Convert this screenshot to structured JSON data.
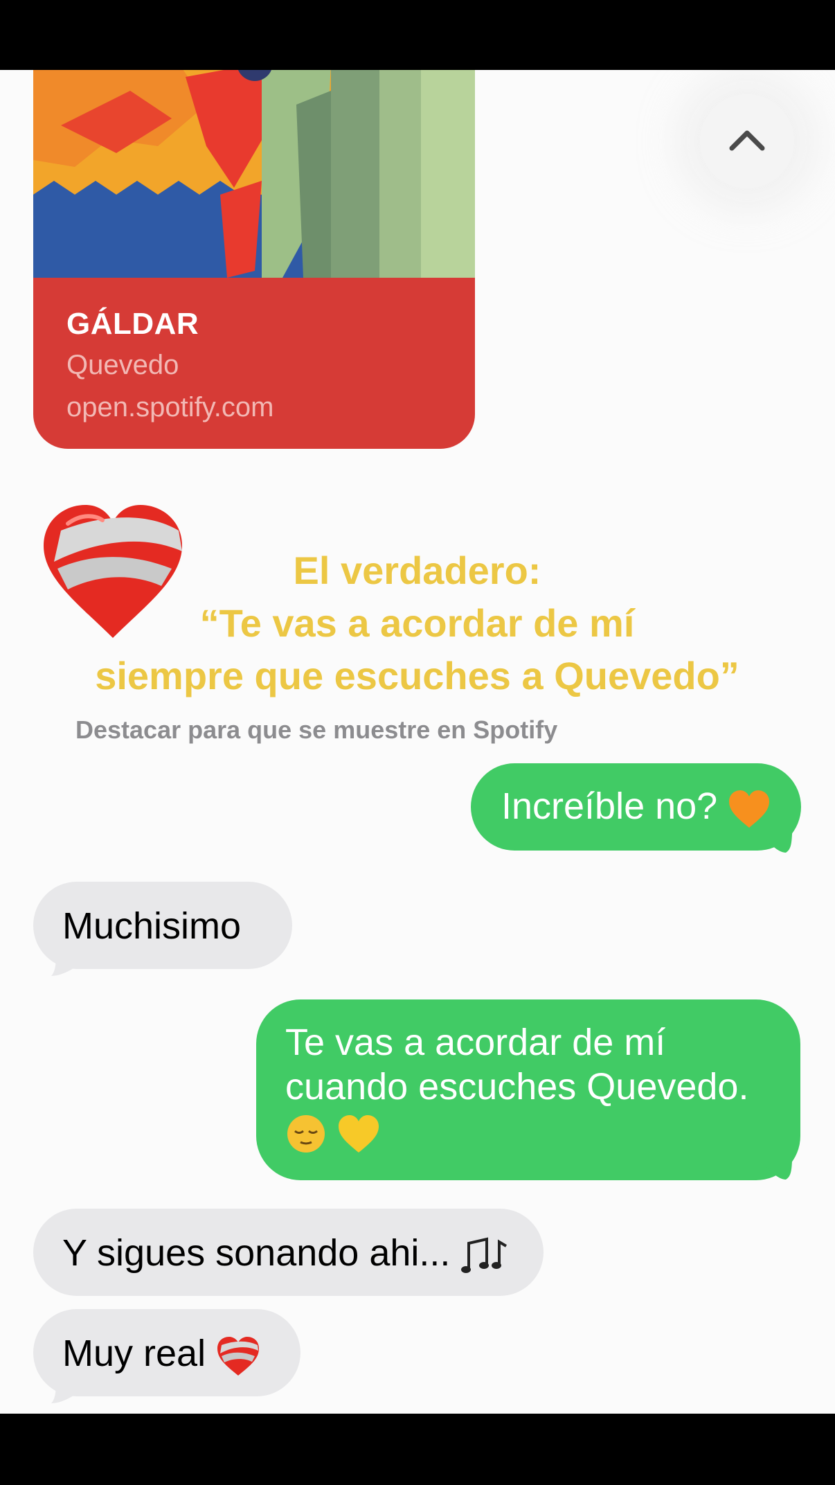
{
  "link_preview": {
    "title": "GÁLDAR",
    "artist": "Quevedo",
    "domain": "open.spotify.com"
  },
  "caption": {
    "line1": "El verdadero:",
    "line2": "“Te vas a acordar de mí",
    "line3": "siempre que escuches a Quevedo”"
  },
  "hint": "Destacar para que se muestre en Spotify",
  "messages": [
    {
      "direction": "sent",
      "text": "Increíble no?"
    },
    {
      "direction": "received",
      "text": "Muchisimo"
    },
    {
      "direction": "sent",
      "line1": "Te vas a acordar de mí",
      "line2": "cuando escuches Quevedo."
    },
    {
      "direction": "received",
      "text": "Y sigues sonando ahi..."
    },
    {
      "direction": "received",
      "text": "Muy real"
    }
  ],
  "icons": {
    "scroll": "chevron-up-icon",
    "reaction": "mending-heart-icon"
  },
  "colors": {
    "sent_bubble": "#41cb65",
    "received_bubble": "#e8e8ea",
    "caption": "#ecc744",
    "card": "#d63b36"
  }
}
